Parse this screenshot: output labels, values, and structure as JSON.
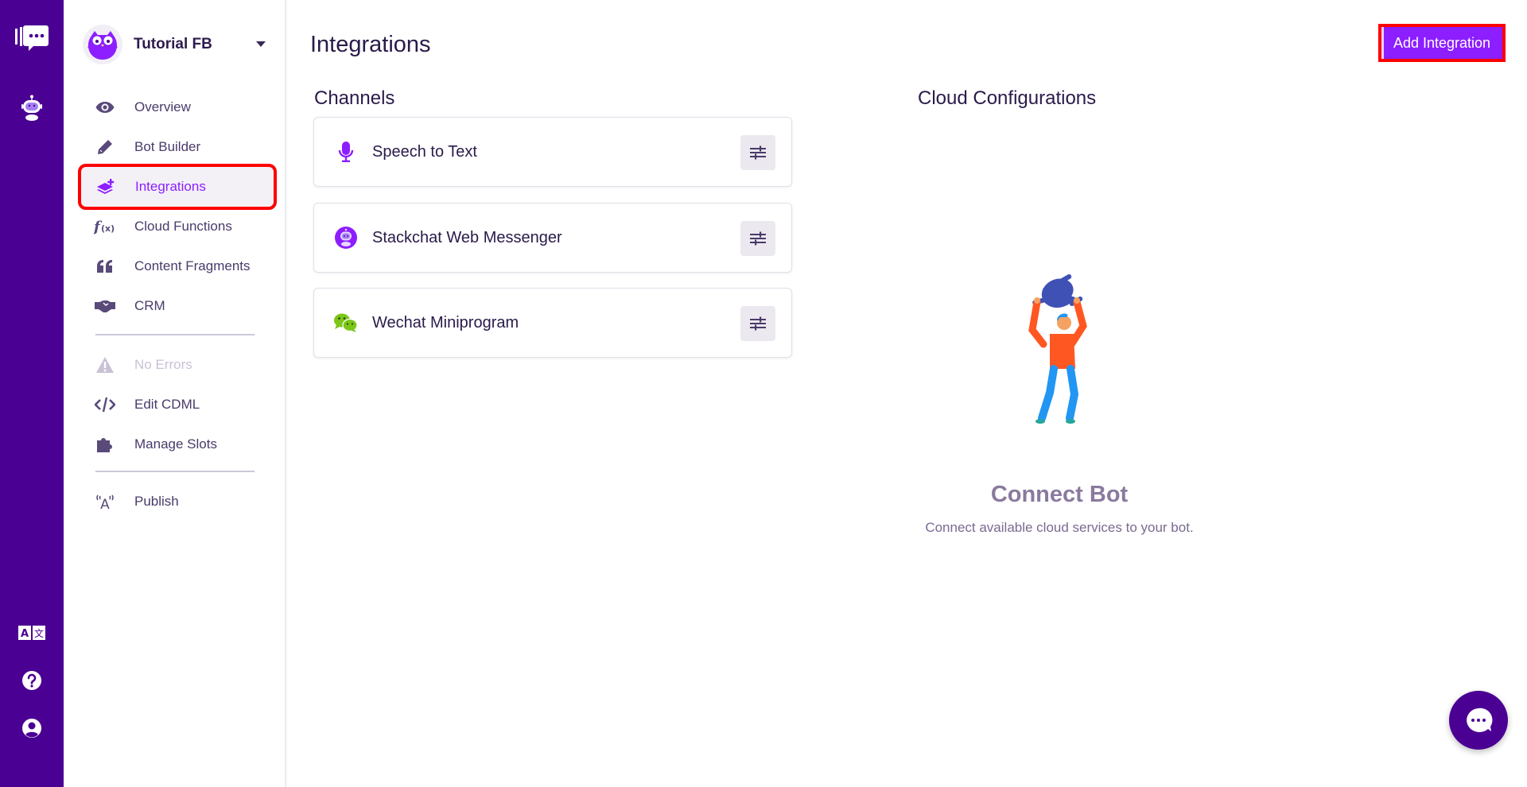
{
  "app": {
    "rail": {
      "top_icons": [
        {
          "name": "app-logo-icon",
          "label": "Stackchat"
        },
        {
          "name": "bot-icon",
          "label": "Bots"
        }
      ],
      "bottom_icons": [
        {
          "name": "translate-icon",
          "label": "Language"
        },
        {
          "name": "help-icon",
          "label": "Help"
        },
        {
          "name": "account-icon",
          "label": "Account"
        }
      ]
    },
    "bot": {
      "name": "Tutorial FB"
    },
    "sidebar": {
      "items": [
        {
          "label": "Overview",
          "icon": "eye-icon",
          "state": "normal"
        },
        {
          "label": "Bot Builder",
          "icon": "pencil-icon",
          "state": "normal"
        },
        {
          "label": "Integrations",
          "icon": "layers-plus-icon",
          "state": "active"
        },
        {
          "label": "Cloud Functions",
          "icon": "function-icon",
          "state": "normal"
        },
        {
          "label": "Content Fragments",
          "icon": "quote-icon",
          "state": "normal"
        },
        {
          "label": "CRM",
          "icon": "handshake-icon",
          "state": "normal"
        },
        {
          "label": "No Errors",
          "icon": "warning-icon",
          "state": "disabled"
        },
        {
          "label": "Edit CDML",
          "icon": "code-icon",
          "state": "normal"
        },
        {
          "label": "Manage Slots",
          "icon": "puzzle-icon",
          "state": "normal"
        },
        {
          "label": "Publish",
          "icon": "broadcast-icon",
          "state": "normal"
        }
      ]
    },
    "main": {
      "title": "Integrations",
      "add_button_label": "Add Integration",
      "channels": {
        "title": "Channels",
        "items": [
          {
            "label": "Speech to Text",
            "icon": "microphone-icon"
          },
          {
            "label": "Stackchat Web Messenger",
            "icon": "stackchat-bot-icon"
          },
          {
            "label": "Wechat Miniprogram",
            "icon": "wechat-icon"
          }
        ]
      },
      "cloud": {
        "title": "Cloud Configurations",
        "empty_title": "Connect Bot",
        "empty_subtitle": "Connect available cloud services to your bot."
      }
    },
    "colors": {
      "rail": "#4b0094",
      "accent": "#8c1eff",
      "highlight_box": "#ff0000",
      "wechat": "#7bc618"
    }
  }
}
